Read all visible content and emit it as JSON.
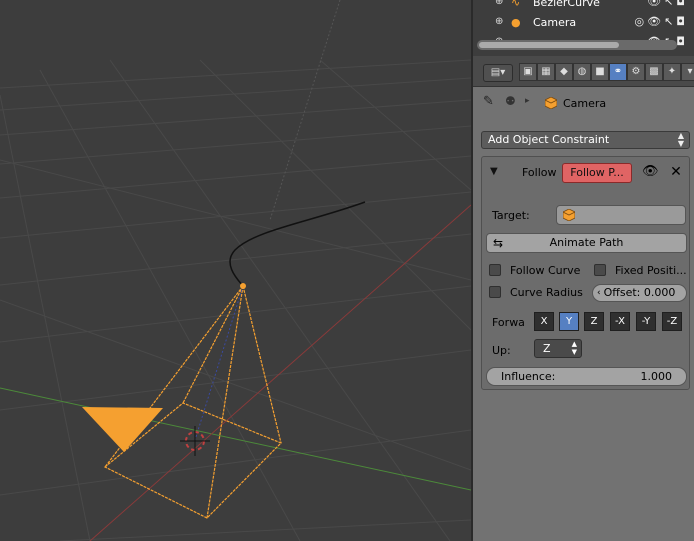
{
  "outliner": {
    "rows": [
      {
        "name": "BezierCurve"
      },
      {
        "name": "Camera"
      },
      {
        "name": ""
      }
    ]
  },
  "properties": {
    "breadcrumb": {
      "object": "Camera"
    },
    "add_constraint": "Add Object Constraint",
    "constraint": {
      "name": "Follow",
      "type": "Follow P...",
      "target_label": "Target:",
      "animate_path": "Animate Path",
      "follow_curve": "Follow Curve",
      "fixed_position": "Fixed Positi...",
      "curve_radius": "Curve Radius",
      "offset": "Offset: 0.000",
      "forward_label": "Forwa",
      "forward_axes": [
        "X",
        "Y",
        "Z",
        "-X",
        "-Y",
        "-Z"
      ],
      "forward_selected": "Y",
      "up_label": "Up:",
      "up_value": "Z",
      "influence_label": "Influence:",
      "influence_value": "1.000"
    }
  },
  "colors": {
    "active_tab": "#5680c2",
    "constraint_type": "#e06464",
    "selection": "#f5a030"
  }
}
